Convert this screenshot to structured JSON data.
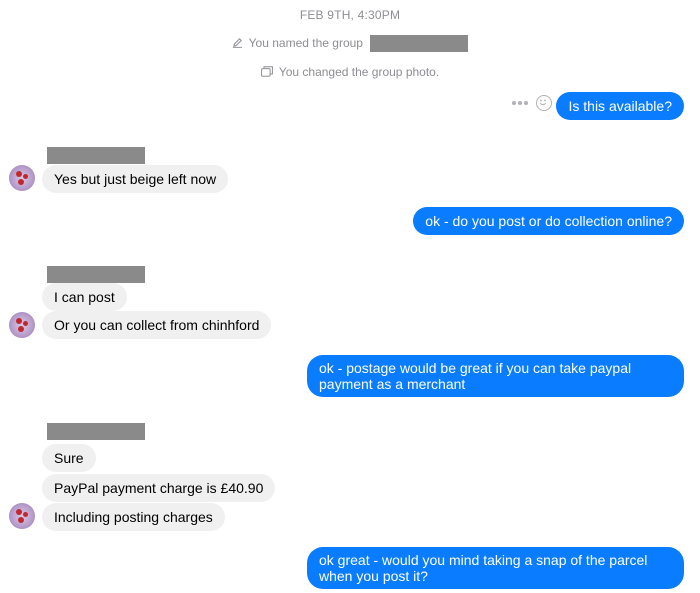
{
  "timestamp": "FEB 9TH, 4:30PM",
  "system": {
    "named_group_text": "You named the group",
    "changed_photo_text": "You changed the group photo."
  },
  "icons": {
    "pencil": "pencil-icon",
    "photo": "photo-icon",
    "more": "more-dots-icon",
    "emoji": "smiley-icon"
  },
  "colors": {
    "outgoing_bubble": "#0a7cff",
    "incoming_bubble": "#f0f0f0",
    "meta_text": "#8e8e93",
    "redaction": "#8a8a8a"
  },
  "messages": [
    {
      "id": "m1",
      "direction": "out",
      "text": "Is this available?"
    },
    {
      "id": "m2",
      "direction": "in",
      "text": "Yes but just beige left now"
    },
    {
      "id": "m3",
      "direction": "out",
      "text": "ok - do you post or do collection online?"
    },
    {
      "id": "m4",
      "direction": "in",
      "text": "I can post"
    },
    {
      "id": "m5",
      "direction": "in",
      "text": "Or you can collect from chinhford"
    },
    {
      "id": "m6",
      "direction": "out",
      "text": "ok - postage would be great if you can take paypal payment as a merchant"
    },
    {
      "id": "m7",
      "direction": "in",
      "text": "Sure"
    },
    {
      "id": "m8",
      "direction": "in",
      "text": "PayPal payment charge is £40.90"
    },
    {
      "id": "m9",
      "direction": "in",
      "text": "Including posting charges"
    },
    {
      "id": "m10",
      "direction": "out",
      "text": "ok great - would you mind taking a snap of the parcel when you post it?"
    }
  ]
}
